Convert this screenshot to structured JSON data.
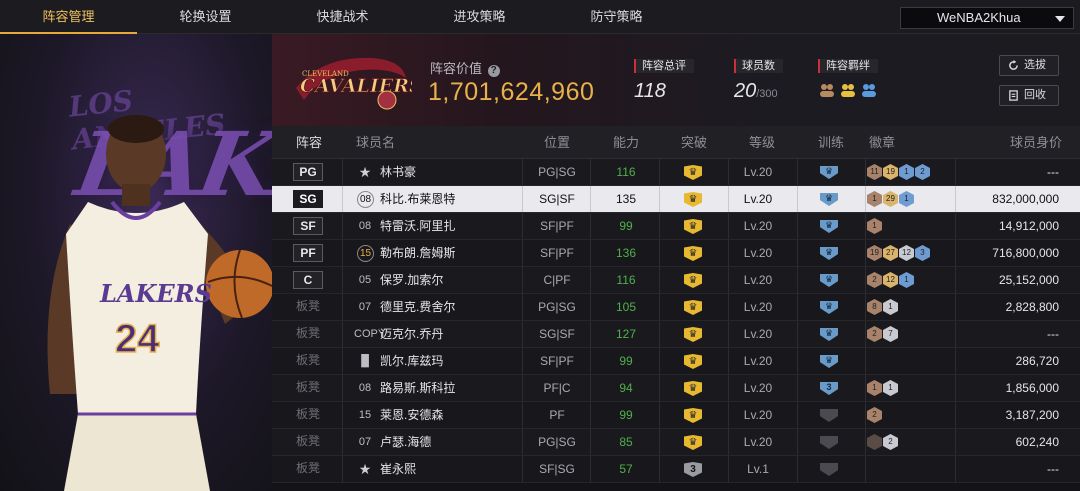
{
  "tabs": [
    {
      "label": "阵容管理",
      "active": true
    },
    {
      "label": "轮换设置",
      "active": false
    },
    {
      "label": "快捷战术",
      "active": false
    },
    {
      "label": "进攻策略",
      "active": false
    },
    {
      "label": "防守策略",
      "active": false
    }
  ],
  "user": {
    "name": "WeNBA2Khua"
  },
  "player_art": {
    "team_text": "LAKERS",
    "arc_text": "LOS ANGELES",
    "jersey_team": "LAKERS",
    "jersey_number": "24"
  },
  "header": {
    "team_logo_text": "CAVALIERS",
    "team_logo_sub": "CLEVELAND",
    "lineup_value_label": "阵容价值",
    "help_icon": "?",
    "lineup_value": "1,701,624,960",
    "overall_label": "阵容总评",
    "overall_value": "118",
    "player_count_label": "球员数",
    "player_count_value": "20",
    "player_count_max": "/300",
    "bonds_label": "阵容羁绊",
    "btn_scout": "选拔",
    "btn_recycle": "回收"
  },
  "columns": {
    "lineup": "阵容",
    "player": "球员名",
    "position": "位置",
    "ability": "能力",
    "breakthrough": "突破",
    "level": "等级",
    "training": "训练",
    "badges": "徽章",
    "value": "球员身价"
  },
  "colors": {
    "accent": "#e8a83a",
    "value_gold": "#e8b14a",
    "ability_green": "#4fb04a",
    "selected_row": "#e9e9ee"
  },
  "rows": [
    {
      "slot": "PG",
      "jersey": "★",
      "name": "林书豪",
      "pos": "PG|SG",
      "ability": "116",
      "brk": "♛",
      "level": "Lv.20",
      "train": "♛",
      "badges": [
        "11",
        "19",
        "1",
        "2"
      ],
      "value": "---"
    },
    {
      "slot": "SG",
      "jersey": "08",
      "name": "科比.布莱恩特",
      "pos": "SG|SF",
      "ability": "135",
      "brk": "♛",
      "level": "Lv.20",
      "train": "♛",
      "badges": [
        "1",
        "29",
        "1"
      ],
      "value": "832,000,000"
    },
    {
      "slot": "SF",
      "jersey": "08",
      "name": "特雷沃.阿里扎",
      "pos": "SF|PF",
      "ability": "99",
      "brk": "♛",
      "level": "Lv.20",
      "train": "♛",
      "badges": [
        "1"
      ],
      "value": "14,912,000"
    },
    {
      "slot": "PF",
      "jersey": "15",
      "name": "勒布朗.詹姆斯",
      "pos": "SF|PF",
      "ability": "136",
      "brk": "♛",
      "level": "Lv.20",
      "train": "♛",
      "badges": [
        "19",
        "27",
        "12",
        "3"
      ],
      "value": "716,800,000"
    },
    {
      "slot": "C",
      "jersey": "05",
      "name": "保罗.加索尔",
      "pos": "C|PF",
      "ability": "116",
      "brk": "♛",
      "level": "Lv.20",
      "train": "♛",
      "badges": [
        "2",
        "12",
        "1"
      ],
      "value": "25,152,000"
    },
    {
      "slot": "板凳",
      "jersey": "07",
      "name": "德里克.费舍尔",
      "pos": "PG|SG",
      "ability": "105",
      "brk": "♛",
      "level": "Lv.20",
      "train": "♛",
      "badges": [
        "8",
        "1"
      ],
      "value": "2,828,800"
    },
    {
      "slot": "板凳",
      "jersey": "COPY",
      "name": "迈克尔.乔丹",
      "pos": "SG|SF",
      "ability": "127",
      "brk": "♛",
      "level": "Lv.20",
      "train": "♛",
      "badges": [
        "2",
        "7"
      ],
      "value": "---"
    },
    {
      "slot": "板凳",
      "jersey": "▐▌",
      "name": "凯尔.库兹玛",
      "pos": "SF|PF",
      "ability": "99",
      "brk": "♛",
      "level": "Lv.20",
      "train": "♛",
      "badges": [],
      "value": "286,720"
    },
    {
      "slot": "板凳",
      "jersey": "08",
      "name": "路易斯.斯科拉",
      "pos": "PF|C",
      "ability": "94",
      "brk": "♛",
      "level": "Lv.20",
      "train": "3",
      "badges": [
        "1",
        "1"
      ],
      "value": "1,856,000"
    },
    {
      "slot": "板凳",
      "jersey": "15",
      "name": "莱恩.安德森",
      "pos": "PF",
      "ability": "99",
      "brk": "♛",
      "level": "Lv.20",
      "train": "",
      "badges": [
        "2"
      ],
      "value": "3,187,200"
    },
    {
      "slot": "板凳",
      "jersey": "07",
      "name": "卢瑟.海德",
      "pos": "PG|SG",
      "ability": "85",
      "brk": "♛",
      "level": "Lv.20",
      "train": "",
      "badges": [
        "",
        "2"
      ],
      "value": "602,240"
    },
    {
      "slot": "板凳",
      "jersey": "★",
      "name": "崔永熙",
      "pos": "SF|SG",
      "ability": "57",
      "brk": "3",
      "level": "Lv.1",
      "train": "",
      "badges": [],
      "value": "---"
    }
  ]
}
